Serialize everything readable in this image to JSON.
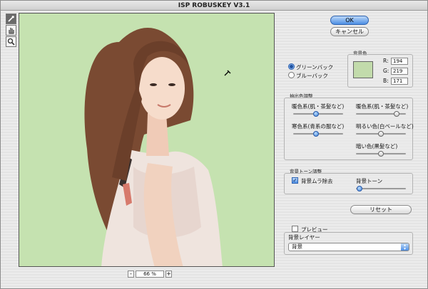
{
  "window": {
    "title": "ISP ROBUSKEY V3.1"
  },
  "tools": [
    {
      "name": "eyedropper-icon",
      "active": true
    },
    {
      "name": "hand-icon",
      "active": false
    },
    {
      "name": "zoom-icon",
      "active": false
    }
  ],
  "zoom": {
    "minus": "-",
    "value": "66 %",
    "plus": "+"
  },
  "buttons": {
    "ok": "OK",
    "cancel": "キャンセル",
    "reset": "リセット"
  },
  "back_mode": {
    "options": [
      {
        "label": "グリーンバック",
        "selected": true
      },
      {
        "label": "ブルーバック",
        "selected": false
      }
    ]
  },
  "bg_color": {
    "title": "背景色",
    "swatch": "#c2dbab",
    "r_label": "R:",
    "r": "194",
    "g_label": "G:",
    "g": "219",
    "b_label": "B:",
    "b": "171"
  },
  "extract": {
    "title": "抽出色調整",
    "sliders": [
      {
        "label": "暖色系(肌・茶髪など)",
        "value": 0.45,
        "blue": true
      },
      {
        "label": "寒色系(青系の服など)",
        "value": 0.45,
        "blue": true
      },
      {
        "label": "暖色系(肌・茶髪など)",
        "value": 0.82,
        "blue": false
      },
      {
        "label": "明るい色(白ベールなど)",
        "value": 0.5,
        "blue": false
      },
      {
        "label": "暗い色(黒髪など)",
        "value": 0.5,
        "blue": false
      }
    ]
  },
  "tone": {
    "title": "背景トーン調整",
    "remove_label": "背景ムラ除去",
    "remove_checked": true,
    "tone_label": "背景トーン",
    "tone_value": 0.07
  },
  "preview_opt": {
    "label": "プレビュー",
    "checked": false
  },
  "layer": {
    "title": "背景レイヤー",
    "selected": "背景"
  },
  "colors": {
    "accent": "#4c8ee4",
    "bg": "#c5e2b0"
  }
}
